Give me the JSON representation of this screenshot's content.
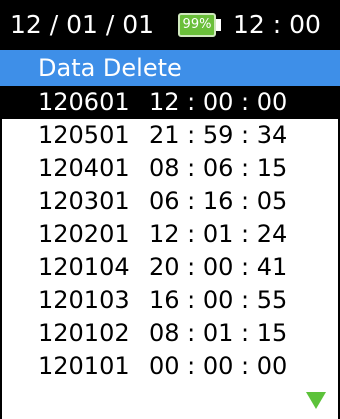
{
  "status": {
    "date": "12 / 01 / 01",
    "battery_percent": "99%",
    "battery_level": 0.99,
    "time": "12 : 00"
  },
  "title": "Data Delete",
  "records": [
    {
      "id": "120601",
      "time": "12 : 00 : 00",
      "selected": true
    },
    {
      "id": "120501",
      "time": "21 : 59 : 34",
      "selected": false
    },
    {
      "id": "120401",
      "time": "08 : 06 : 15",
      "selected": false
    },
    {
      "id": "120301",
      "time": "06 : 16 : 05",
      "selected": false
    },
    {
      "id": "120201",
      "time": "12 : 01 : 24",
      "selected": false
    },
    {
      "id": "120104",
      "time": "20 : 00 : 41",
      "selected": false
    },
    {
      "id": "120103",
      "time": "16 : 00 : 55",
      "selected": false
    },
    {
      "id": "120102",
      "time": "08 : 01 : 15",
      "selected": false
    },
    {
      "id": "120101",
      "time": "00 : 00 : 00",
      "selected": false
    }
  ],
  "icons": {
    "scroll_down": "scroll-down-arrow-icon",
    "battery": "battery-icon"
  },
  "colors": {
    "header_bg": "#000000",
    "title_bg": "#3e8fe8",
    "battery_fill": "#6abf3a",
    "scroll_arrow": "#5cc23a",
    "selected_row_bg": "#000000"
  }
}
